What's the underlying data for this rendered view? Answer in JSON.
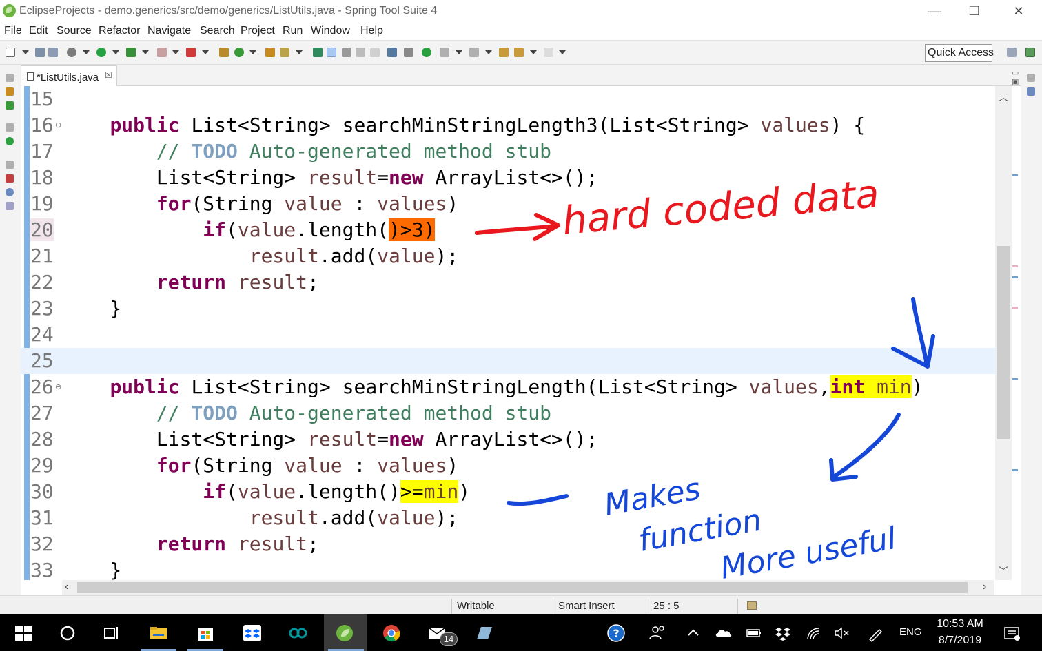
{
  "window": {
    "title": "EclipseProjects - demo.generics/src/demo/generics/ListUtils.java - Spring Tool Suite 4",
    "minimize": "—",
    "restore": "❐",
    "close": "✕"
  },
  "menu": [
    "File",
    "Edit",
    "Source",
    "Refactor",
    "Navigate",
    "Search",
    "Project",
    "Run",
    "Window",
    "Help"
  ],
  "toolbar": {
    "quick_access": "Quick Access"
  },
  "editor": {
    "tab_label": "*ListUtils.java",
    "tab_close": "☒",
    "line_numbers": [
      "15",
      "16",
      "17",
      "18",
      "19",
      "20",
      "21",
      "22",
      "23",
      "24",
      "25",
      "26",
      "27",
      "28",
      "29",
      "30",
      "31",
      "32",
      "33"
    ]
  },
  "statusbar": {
    "mode": "Writable",
    "insert": "Smart Insert",
    "position": "25 : 5"
  },
  "taskbar": {
    "time": "10:53 AM",
    "date": "8/7/2019",
    "language": "ENG",
    "mail_badge": "14"
  },
  "annotations": {
    "red_note": "hard coded data",
    "blue_note": "Makes function More useful"
  },
  "colors": {
    "keyword": "#7f0055",
    "comment": "#3f7f5f",
    "todo": "#7f9fbf",
    "variable": "#6a3e3e",
    "highlight_orange": "#ff6a00",
    "highlight_yellow": "#ffff00",
    "ink_red": "#e8181e",
    "ink_blue": "#1446d8"
  }
}
